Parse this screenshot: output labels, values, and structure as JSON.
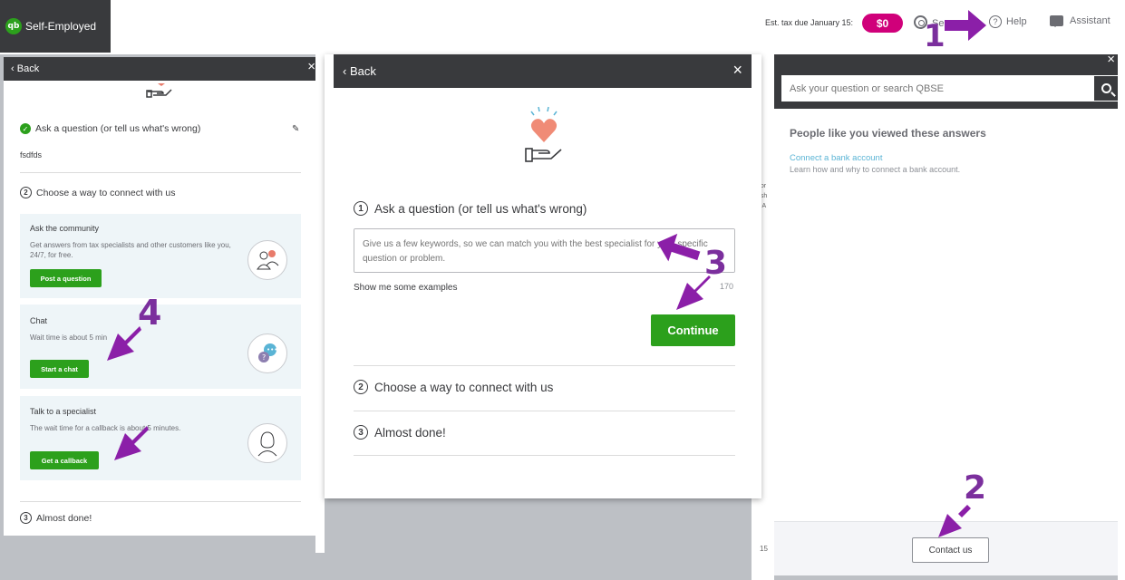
{
  "topbar": {
    "logo_text": "qb",
    "app_name": "Self-Employed",
    "est_tax_label": "Est. tax due January 15:",
    "est_tax_value": "$0",
    "settings_fragment": "Se",
    "help_label": "Help",
    "assistant_label": "Assistant"
  },
  "left_panel": {
    "back_label": "Back",
    "close_label": "×",
    "step1_label": "Ask a question (or tell us what's wrong)",
    "step1_answer": "fsdfds",
    "step2_num": "2",
    "step2_label": "Choose a way to connect with us",
    "cards": [
      {
        "title": "Ask the community",
        "desc": "Get answers from tax specialists and other customers like you, 24/7, for free.",
        "button": "Post a question"
      },
      {
        "title": "Chat",
        "desc": "Wait time is about 5 min",
        "button": "Start a chat"
      },
      {
        "title": "Talk to a specialist",
        "desc": "The wait time for a callback is about 5 minutes.",
        "button": "Get a callback"
      }
    ],
    "step3_num": "3",
    "step3_label": "Almost done!"
  },
  "center_panel": {
    "back_label": "Back",
    "close_label": "×",
    "step1_num": "1",
    "step1_label": "Ask a question (or tell us what's wrong)",
    "input_placeholder": "Give us a few keywords, so we can match you with the best specialist for your specific question or problem.",
    "examples_link": "Show me some examples",
    "char_count": "170",
    "continue_label": "Continue",
    "step2_num": "2",
    "step2_label": "Choose a way to connect with us",
    "step3_num": "3",
    "step3_label": "Almost done!"
  },
  "right_panel": {
    "close_label": "×",
    "search_placeholder": "Ask your question or search QBSE",
    "heading": "People like you viewed these answers",
    "link": "Connect a bank account",
    "link_sub": "Learn how and why to connect a bank account.",
    "contact_label": "Contact us"
  },
  "background": {
    "sliver_text_1": "oor",
    "sliver_text_2": "t sh",
    "sliver_text_3": "n A",
    "sliver_text_4": "15"
  },
  "annotations": {
    "n1": "1",
    "n2": "2",
    "n3": "3",
    "n4": "4"
  },
  "colors": {
    "accent_green": "#2ca01c",
    "tax_pink": "#d0007a",
    "header_dark": "#393a3d",
    "annotation_purple": "#7b2f9d",
    "link_blue": "#5ab4d5"
  }
}
